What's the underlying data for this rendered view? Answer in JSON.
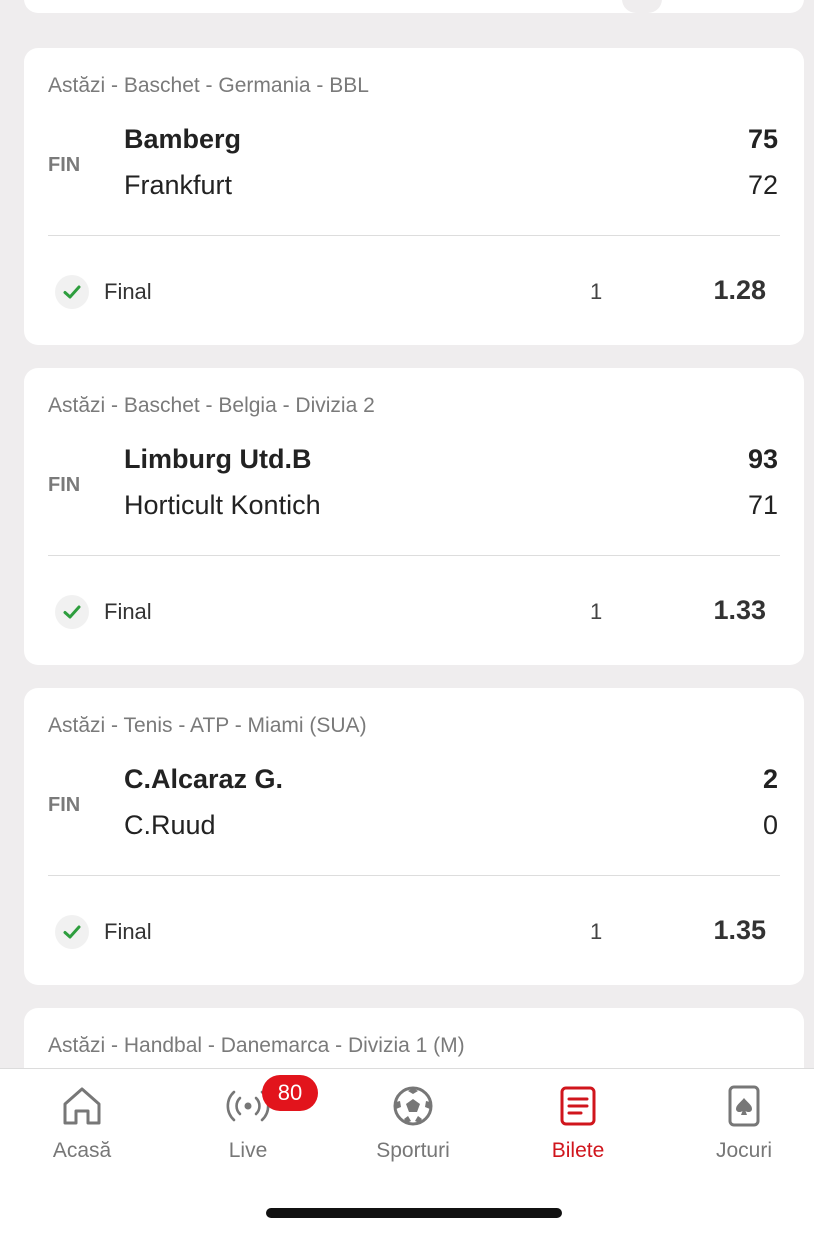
{
  "matches": [
    {
      "league": "Astăzi - Baschet - Germania - BBL",
      "status": "FIN",
      "home": "Bamberg",
      "home_score": "75",
      "away": "Frankfurt",
      "away_score": "72",
      "bet": "Final",
      "pick": "1",
      "odd": "1.28"
    },
    {
      "league": "Astăzi - Baschet - Belgia - Divizia 2",
      "status": "FIN",
      "home": "Limburg Utd.B",
      "home_score": "93",
      "away": "Horticult Kontich",
      "away_score": "71",
      "bet": "Final",
      "pick": "1",
      "odd": "1.33"
    },
    {
      "league": "Astăzi - Tenis - ATP - Miami (SUA)",
      "status": "FIN",
      "home": "C.Alcaraz G.",
      "home_score": "2",
      "away": "C.Ruud",
      "away_score": "0",
      "bet": "Final",
      "pick": "1",
      "odd": "1.35"
    }
  ],
  "partial_match": {
    "league": "Astăzi - Handbal - Danemarca - Divizia 1 (M)"
  },
  "nav": {
    "items": [
      {
        "label": "Acasă",
        "icon": "home-icon"
      },
      {
        "label": "Live",
        "icon": "live-broadcast-icon"
      },
      {
        "label": "Sporturi",
        "icon": "soccer-ball-icon"
      },
      {
        "label": "Bilete",
        "icon": "ticket-list-icon"
      },
      {
        "label": "Jocuri",
        "icon": "playing-card-icon"
      }
    ],
    "live_badge": "80",
    "active": "Bilete"
  },
  "colors": {
    "accent": "#d0151c",
    "badge": "#e2141c",
    "check": "#2e9e3e",
    "background": "#efedee"
  }
}
